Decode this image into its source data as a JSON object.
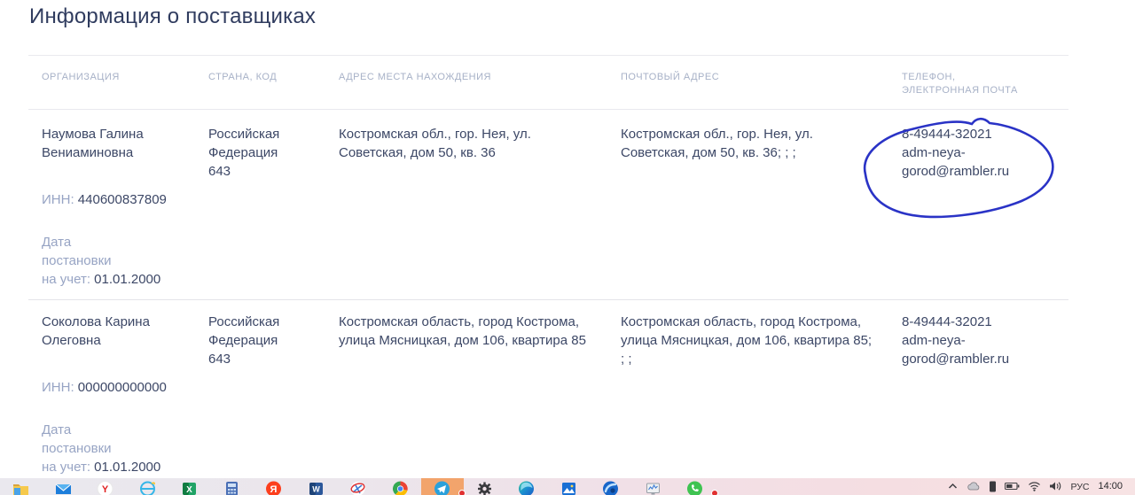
{
  "page": {
    "title": "Информация о поставщиках"
  },
  "table": {
    "columns": [
      {
        "label": "ОРГАНИЗАЦИЯ"
      },
      {
        "label": "СТРАНА, КОД"
      },
      {
        "label": "АДРЕС МЕСТА НАХОЖДЕНИЯ"
      },
      {
        "label": "ПОЧТОВЫЙ АДРЕС"
      },
      {
        "label_line1": "ТЕЛЕФОН,",
        "label_line2": "ЭЛЕКТРОННАЯ ПОЧТА"
      }
    ]
  },
  "labels": {
    "inn": "ИНН:",
    "reg_line1": "Дата",
    "reg_line2": "постановки",
    "reg_line3": "на учет:"
  },
  "suppliers": [
    {
      "name": "Наумова Галина Вениаминовна",
      "inn": "440600837809",
      "reg_date": "01.01.2000",
      "country": "Российская Федерация",
      "country_code": "643",
      "address": "Костромская обл., гор. Нея, ул. Советская, дом 50, кв. 36",
      "postal_address": "Костромская обл., гор. Нея, ул. Советская, дом 50, кв. 36; ; ;",
      "phone": "8-49444-32021",
      "email": "adm-neya-gorod@rambler.ru"
    },
    {
      "name": "Соколова Карина Олеговна",
      "inn": "000000000000",
      "reg_date": "01.01.2000",
      "country": "Российская Федерация",
      "country_code": "643",
      "address": "Костромская область, город Кострома, улица Мясницкая, дом 106, квартира 85",
      "postal_address": "Костромская область, город Кострома, улица Мясницкая, дом 106, квартира 85; ; ;",
      "phone": "8-49444-32021",
      "email": "adm-neya-gorod@rambler.ru"
    }
  ],
  "annotation": {
    "shape": "hand-drawn-circle",
    "color": "#2a33c6",
    "target": "phone-email-of-first-supplier"
  },
  "taskbar": {
    "icons": [
      "file-explorer",
      "mail",
      "yandex-browser",
      "internet-explorer",
      "excel",
      "calculator",
      "yandex-search",
      "word",
      "blocked-app",
      "chrome",
      "telegram",
      "settings",
      "edge",
      "photos",
      "browser-blue",
      "task-manager",
      "whatsapp"
    ],
    "active_icon": "telegram",
    "tray": {
      "language": "РУС",
      "time": "14:00"
    }
  }
}
